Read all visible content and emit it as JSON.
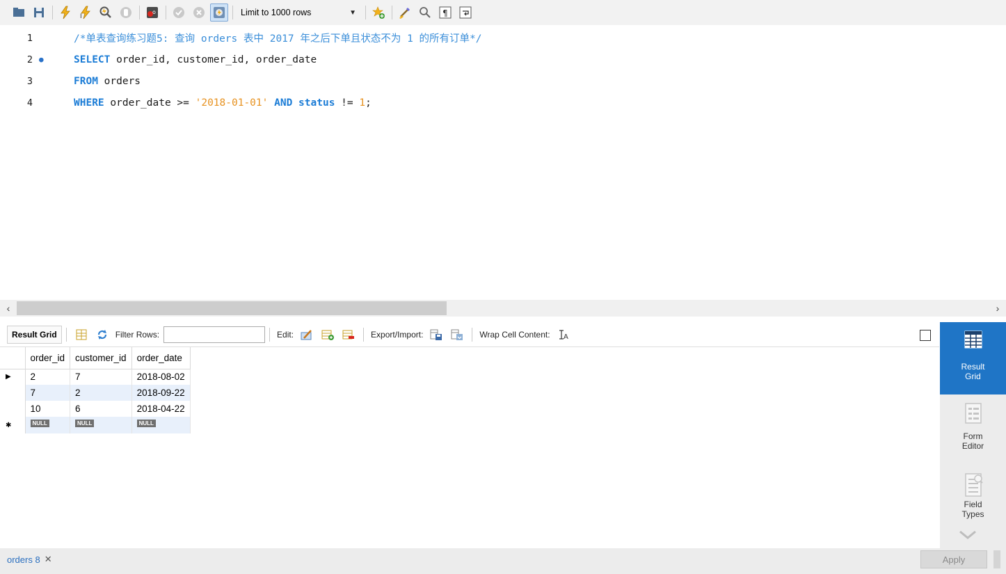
{
  "toolbar": {
    "limit_label": "Limit to 1000 rows",
    "icons": [
      "folder-icon",
      "save-icon",
      "execute-icon",
      "execute-current-icon",
      "explain-icon",
      "stop-icon",
      "toggle-error-icon",
      "commit-icon",
      "rollback-icon",
      "autocommit-icon",
      "add-snippet-icon",
      "beautify-icon",
      "find-icon",
      "invisible-chars-icon",
      "wrap-icon"
    ]
  },
  "editor": {
    "lines": [
      {
        "number": "1",
        "text": "/*单表查询练习题5: 查询 orders 表中 2017 年之后下单且状态不为 1 的所有订单*/"
      },
      {
        "number": "2",
        "text": "SELECT order_id, customer_id, order_date"
      },
      {
        "number": "3",
        "text": "FROM orders"
      },
      {
        "number": "4",
        "text": "WHERE order_date >= '2018-01-01' AND status != 1;"
      }
    ],
    "marker_line": "2"
  },
  "result_toolbar": {
    "result_grid_label": "Result Grid",
    "filter_rows_label": "Filter Rows:",
    "filter_value": "",
    "edit_label": "Edit:",
    "export_import_label": "Export/Import:",
    "wrap_label": "Wrap Cell Content:"
  },
  "grid": {
    "columns": [
      "order_id",
      "customer_id",
      "order_date"
    ],
    "rows": [
      [
        "2",
        "7",
        "2018-08-02"
      ],
      [
        "7",
        "2",
        "2018-09-22"
      ],
      [
        "10",
        "6",
        "2018-04-22"
      ]
    ],
    "null_label": "NULL"
  },
  "side_panel": {
    "items": [
      {
        "label1": "Result",
        "label2": "Grid",
        "active": true
      },
      {
        "label1": "Form",
        "label2": "Editor",
        "active": false
      },
      {
        "label1": "Field",
        "label2": "Types",
        "active": false
      }
    ]
  },
  "bottom": {
    "tab_label": "orders 8",
    "apply_label": "Apply"
  },
  "colors": {
    "accent": "#1f75c6",
    "keyword": "#1b7cd6",
    "string": "#e79220",
    "comment": "#3a8ed9"
  }
}
